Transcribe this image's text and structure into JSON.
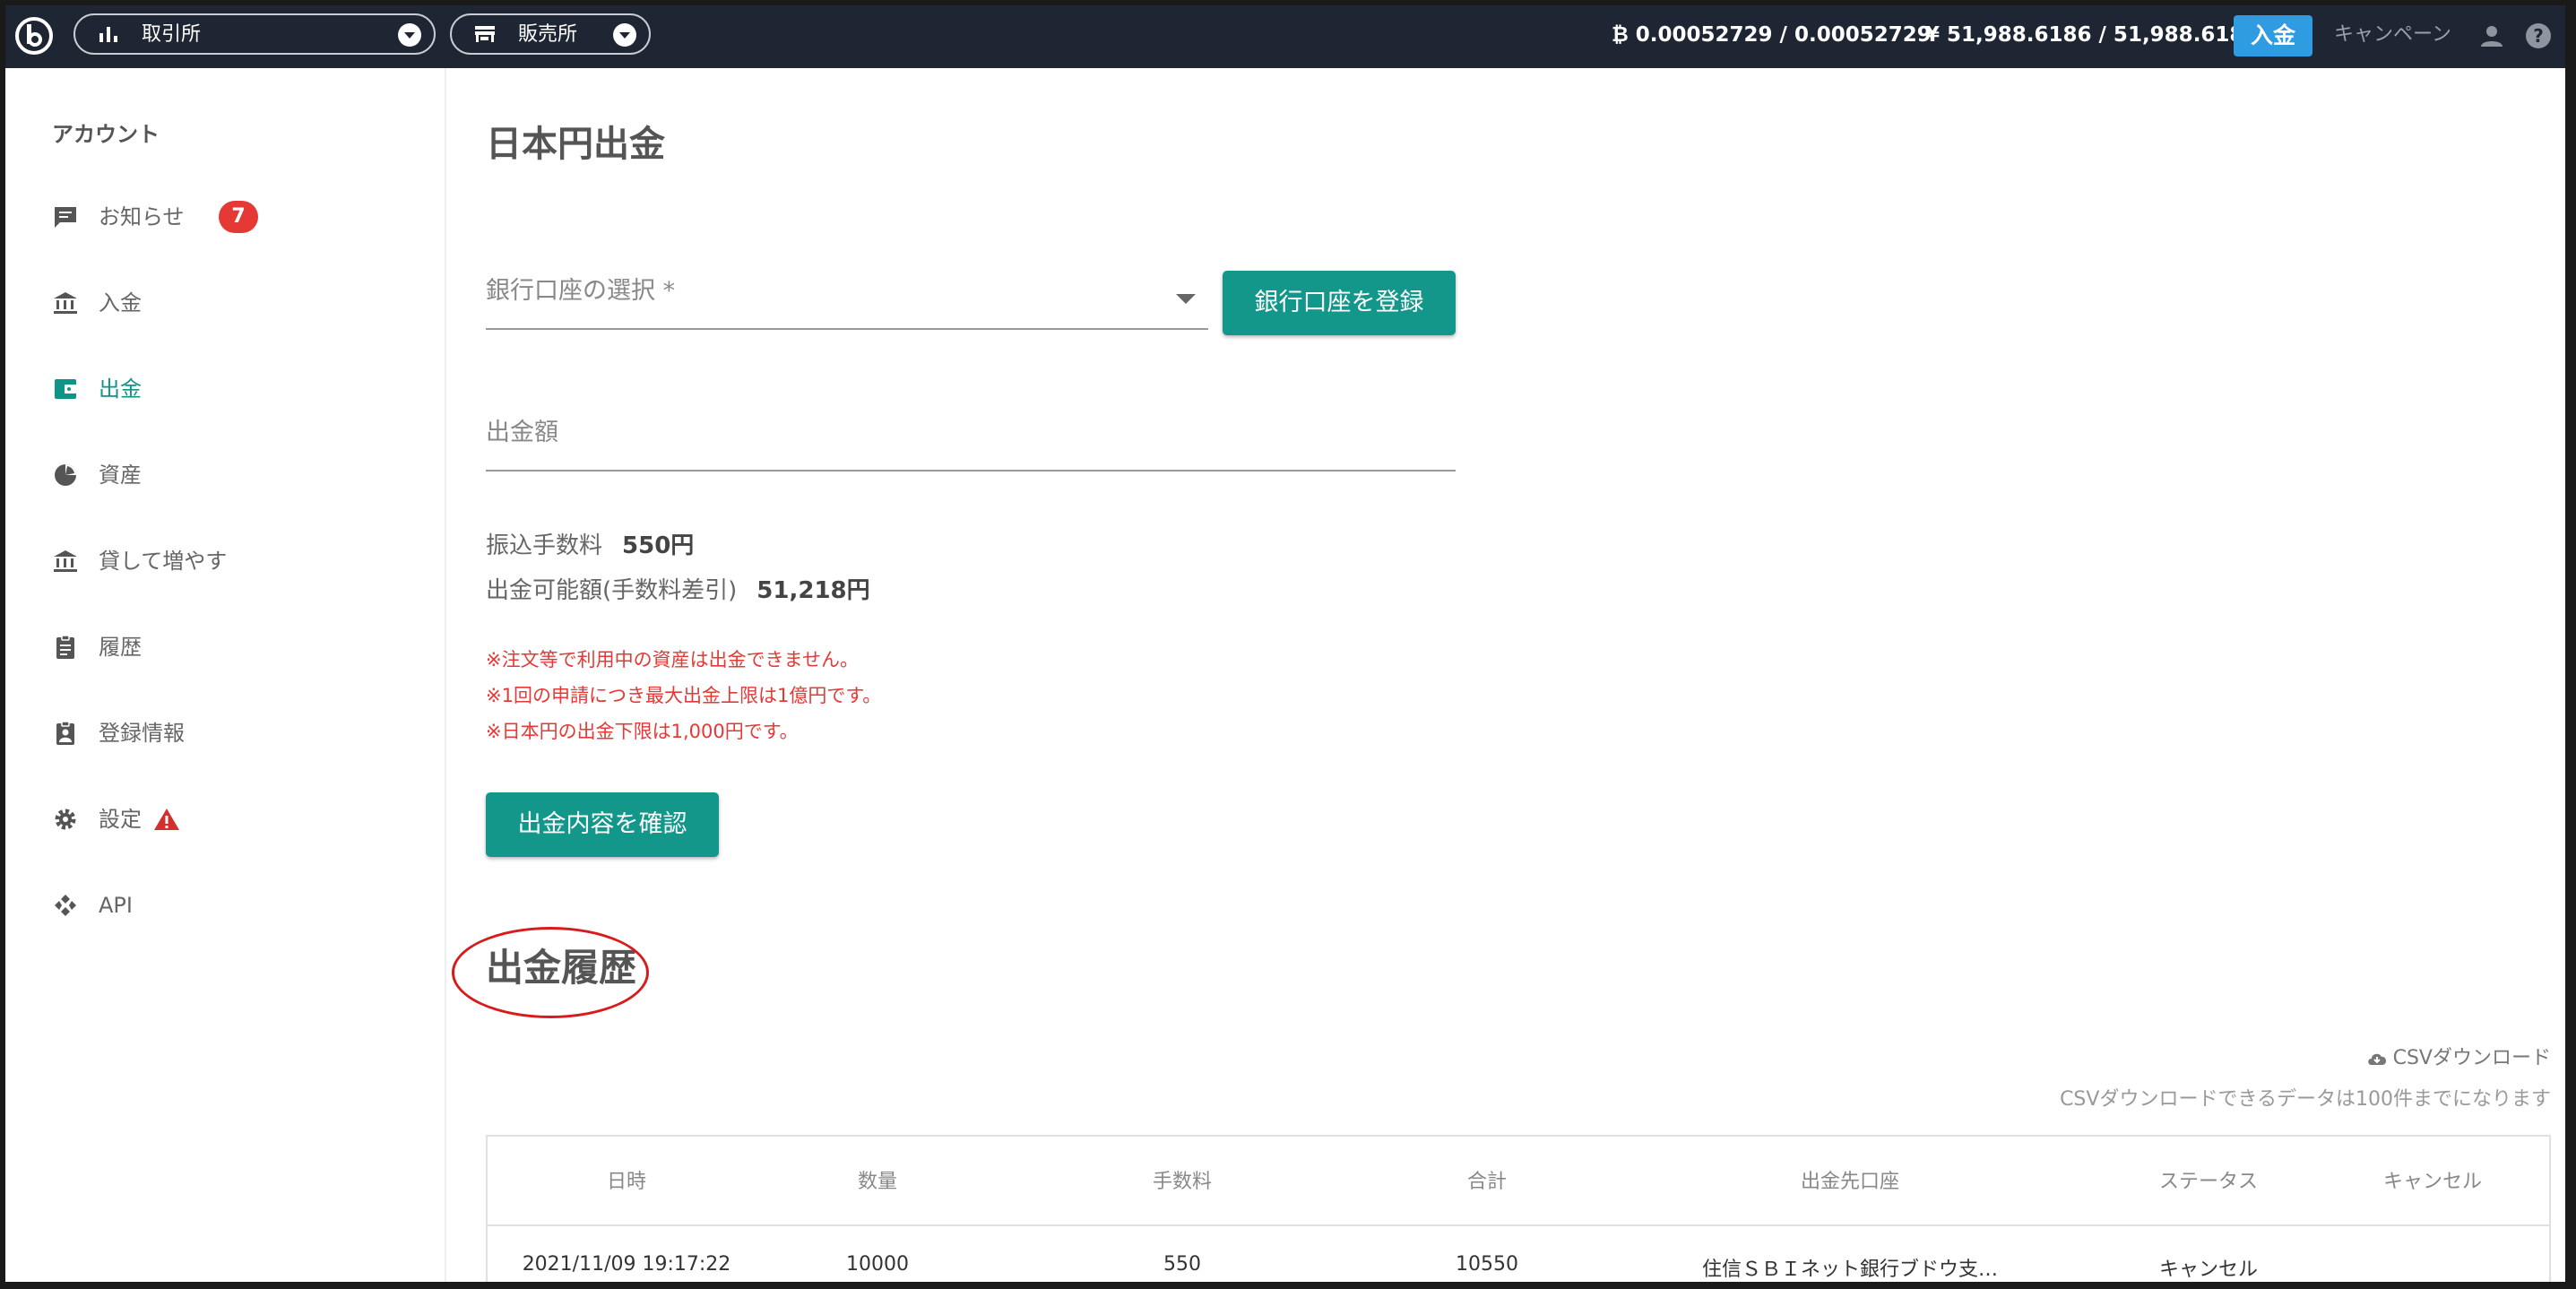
{
  "header": {
    "nav": [
      {
        "label": "取引所",
        "icon": "bar-chart-icon"
      },
      {
        "label": "販売所",
        "icon": "store-icon"
      }
    ],
    "btc_balance": "0.00052729 / 0.00052729",
    "jpy_balance": "51,988.6186 / 51,988.6186",
    "deposit_label": "入金",
    "campaign_label": "キャンペーン"
  },
  "sidebar": {
    "title": "アカウント",
    "items": [
      {
        "label": "お知らせ",
        "icon": "message-icon",
        "badge": "7"
      },
      {
        "label": "入金",
        "icon": "bank-icon"
      },
      {
        "label": "出金",
        "icon": "wallet-icon",
        "active": true
      },
      {
        "label": "資産",
        "icon": "pie-chart-icon"
      },
      {
        "label": "貸して増やす",
        "icon": "bank-icon"
      },
      {
        "label": "履歴",
        "icon": "clipboard-icon"
      },
      {
        "label": "登録情報",
        "icon": "id-badge-icon"
      },
      {
        "label": "設定",
        "icon": "gear-icon",
        "warning": true
      },
      {
        "label": "API",
        "icon": "api-icon"
      }
    ]
  },
  "main": {
    "title": "日本円出金",
    "bank_select_placeholder": "銀行口座の選択 *",
    "register_bank_label": "銀行口座を登録",
    "amount_placeholder": "出金額",
    "fee_label": "振込手数料",
    "fee_value": "550円",
    "available_label": "出金可能額(手数料差引)",
    "available_value": "51,218円",
    "notes": [
      "※注文等で利用中の資産は出金できません。",
      "※1回の申請につき最大出金上限は1億円です。",
      "※日本円の出金下限は1,000円です。"
    ],
    "confirm_label": "出金内容を確認",
    "history_title": "出金履歴",
    "csv_download_label": "CSVダウンロード",
    "csv_note": "CSVダウンロードできるデータは100件までになります",
    "table": {
      "headers": [
        "日時",
        "数量",
        "手数料",
        "合計",
        "出金先口座",
        "ステータス",
        "キャンセル"
      ],
      "rows": [
        [
          "2021/11/09 19:17:22",
          "10000",
          "550",
          "10550",
          "住信ＳＢＩネット銀行ブドウ支…",
          "キャンセル",
          ""
        ]
      ]
    }
  },
  "colors": {
    "header_bg": "#1e2533",
    "accent_teal": "#12978a",
    "deposit_blue": "#2f9be0",
    "alert_red": "#e53935"
  }
}
